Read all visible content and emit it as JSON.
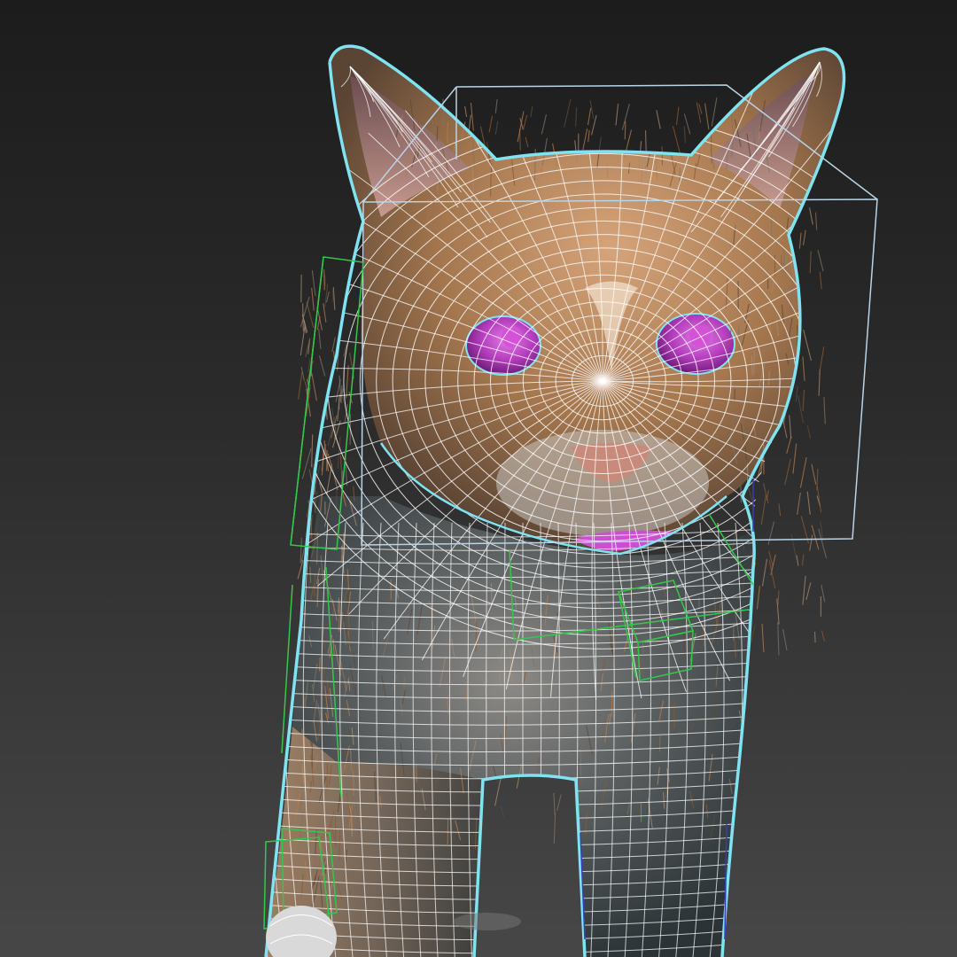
{
  "viewport": {
    "name": "3d-perspective-viewport",
    "background_top": "#1c1c1c",
    "background_bottom": "#474747"
  },
  "model": {
    "subject": "cat",
    "fur_color": "#b07a4a",
    "fur_dark": "#3c4650",
    "eye_color": "#c23ac8",
    "nose_color": "#c88a7a",
    "wire_color": "#ffffff",
    "selection_outline": "#7fe3f2",
    "bone_color": "#33c84a",
    "bbox_color": "#b8d4e6"
  }
}
